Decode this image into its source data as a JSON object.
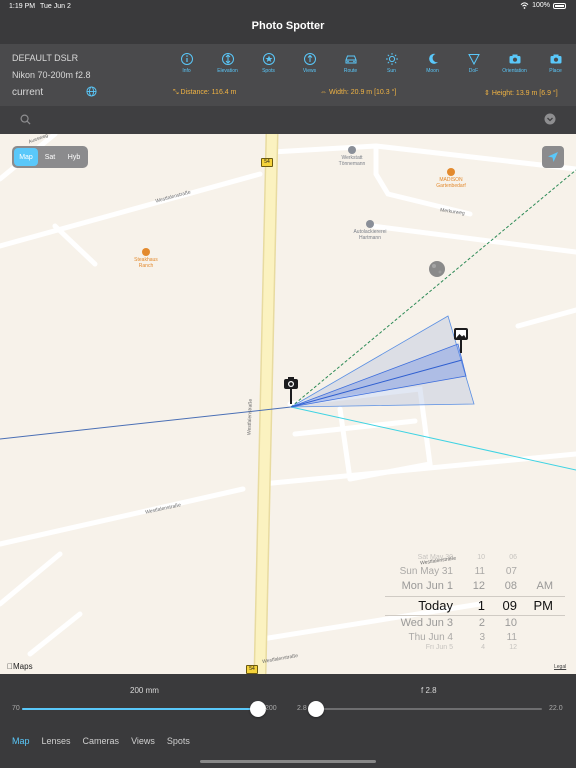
{
  "status": {
    "time": "1:19 PM",
    "date": "Tue Jun 2",
    "battery": "100%"
  },
  "nav": {
    "title": "Photo Spotter"
  },
  "camera": {
    "body": "DEFAULT DSLR",
    "lens": "Nikon 70-200m f2.8",
    "location": "current"
  },
  "toolbar": [
    {
      "label": "Info",
      "icon": "info-icon"
    },
    {
      "label": "Elevation",
      "icon": "elevation-icon"
    },
    {
      "label": "Spots",
      "icon": "star-icon"
    },
    {
      "label": "Views",
      "icon": "views-icon"
    },
    {
      "label": "Route",
      "icon": "car-icon"
    },
    {
      "label": "Sun",
      "icon": "sun-icon"
    },
    {
      "label": "Moon",
      "icon": "moon-icon"
    },
    {
      "label": "DoF",
      "icon": "dof-icon"
    },
    {
      "label": "Orientation",
      "icon": "camera-icon"
    },
    {
      "label": "Place",
      "icon": "camera-icon"
    }
  ],
  "measurements": {
    "distance": "Distance: 116.4 m",
    "width": "Width: 20.9 m [10.3 °]",
    "height": "Height: 13.9 m [6.9 °]"
  },
  "map": {
    "types": [
      "Map",
      "Sat",
      "Hyb"
    ],
    "active_type": "Map",
    "pois": [
      {
        "name": "Werkstatt\nTönnemann"
      },
      {
        "name": "MADISON\nGartenbedarf"
      },
      {
        "name": "Autolackiererei\nHartmann"
      },
      {
        "name": "Steakhaus\nRanch"
      }
    ],
    "streets": [
      "Westfalenstraße",
      "Westfalenstraße",
      "Westfalenstraße",
      "Westfalenstraße",
      "Westfalenstraße",
      "Merkurweg",
      "Auesweg"
    ],
    "route_shields": [
      "54",
      "54"
    ],
    "attribution": "Maps",
    "legal": "Legal"
  },
  "date_picker": {
    "rows": [
      {
        "day": "Sat May 30",
        "hour": "10",
        "minute": "06",
        "ampm": ""
      },
      {
        "day": "Sun May 31",
        "hour": "11",
        "minute": "07",
        "ampm": ""
      },
      {
        "day": "Mon Jun 1",
        "hour": "12",
        "minute": "08",
        "ampm": "AM"
      },
      {
        "day": "Today",
        "hour": "1",
        "minute": "09",
        "ampm": "PM"
      },
      {
        "day": "Wed Jun 3",
        "hour": "2",
        "minute": "10",
        "ampm": ""
      },
      {
        "day": "Thu Jun 4",
        "hour": "3",
        "minute": "11",
        "ampm": ""
      },
      {
        "day": "Fri Jun 5",
        "hour": "4",
        "minute": "12",
        "ampm": ""
      }
    ]
  },
  "focal_slider": {
    "label": "200 mm",
    "min": "70",
    "max": "200",
    "value": 200,
    "min_value": 70,
    "max_value": 200
  },
  "aperture_slider": {
    "label": "f 2.8",
    "min": "2.8",
    "max": "22.0",
    "value": 2.8,
    "min_value": 2.8,
    "max_value": 22.0
  },
  "tabs": [
    "Map",
    "Lenses",
    "Cameras",
    "Views",
    "Spots"
  ],
  "active_tab": "Map",
  "colors": {
    "accent": "#5ac8fa",
    "measure": "#f0b343",
    "poi_orange": "#e38a2e",
    "poi_gray": "#7a7f88"
  }
}
